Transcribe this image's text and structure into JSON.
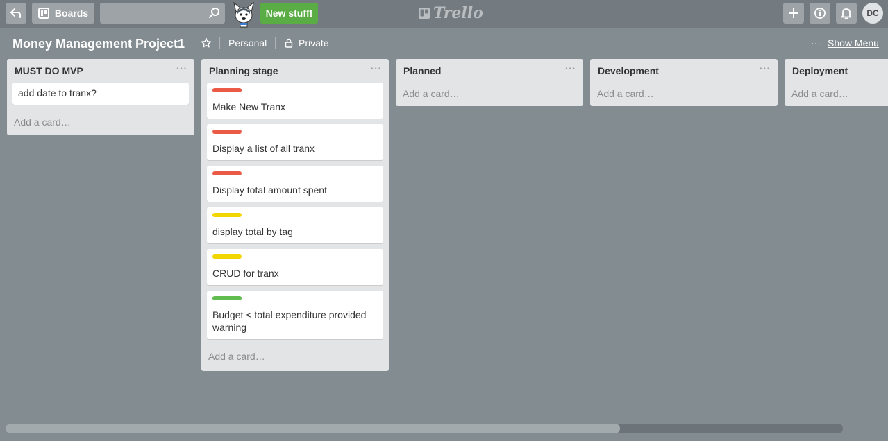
{
  "header": {
    "boards_label": "Boards",
    "search": {
      "value": "",
      "placeholder": ""
    },
    "new_stuff_label": "New stuff!",
    "logo_text": "Trello",
    "avatar_initials": "DC"
  },
  "board": {
    "title": "Money Management Project1",
    "team": "Personal",
    "visibility": "Private",
    "menu_dots": "···",
    "show_menu_label": "Show Menu"
  },
  "lists": [
    {
      "title": "MUST DO MVP",
      "menu": "···",
      "cards": [
        {
          "text": "add date to tranx?"
        }
      ],
      "add_card": "Add a card…"
    },
    {
      "title": "Planning stage",
      "menu": "···",
      "cards": [
        {
          "label_color": "#eb5a46",
          "text": "Make New Tranx"
        },
        {
          "label_color": "#eb5a46",
          "text": "Display a list of all tranx"
        },
        {
          "label_color": "#eb5a46",
          "text": "Display total amount spent"
        },
        {
          "label_color": "#f2d600",
          "text": "display total by tag"
        },
        {
          "label_color": "#f2d600",
          "text": "CRUD for tranx"
        },
        {
          "label_color": "#61bd4f",
          "text": "Budget < total expenditure provided warning"
        }
      ],
      "add_card": "Add a card…"
    },
    {
      "title": "Planned",
      "menu": "···",
      "cards": [],
      "add_card": "Add a card…"
    },
    {
      "title": "Development",
      "menu": "···",
      "cards": [],
      "add_card": "Add a card…"
    },
    {
      "title": "Deployment",
      "menu": "···",
      "cards": [],
      "add_card": "Add a card…"
    }
  ],
  "icons": {
    "back": "back-arrow-icon",
    "boards": "boards-icon",
    "search": "search-icon",
    "add": "plus-icon",
    "info": "info-icon",
    "notifications": "bell-icon",
    "star": "star-icon",
    "lock": "lock-icon"
  },
  "colors": {
    "background": "#838c91",
    "header": "#737b80",
    "new_stuff": "#5aac44",
    "list": "#e2e4e6"
  }
}
